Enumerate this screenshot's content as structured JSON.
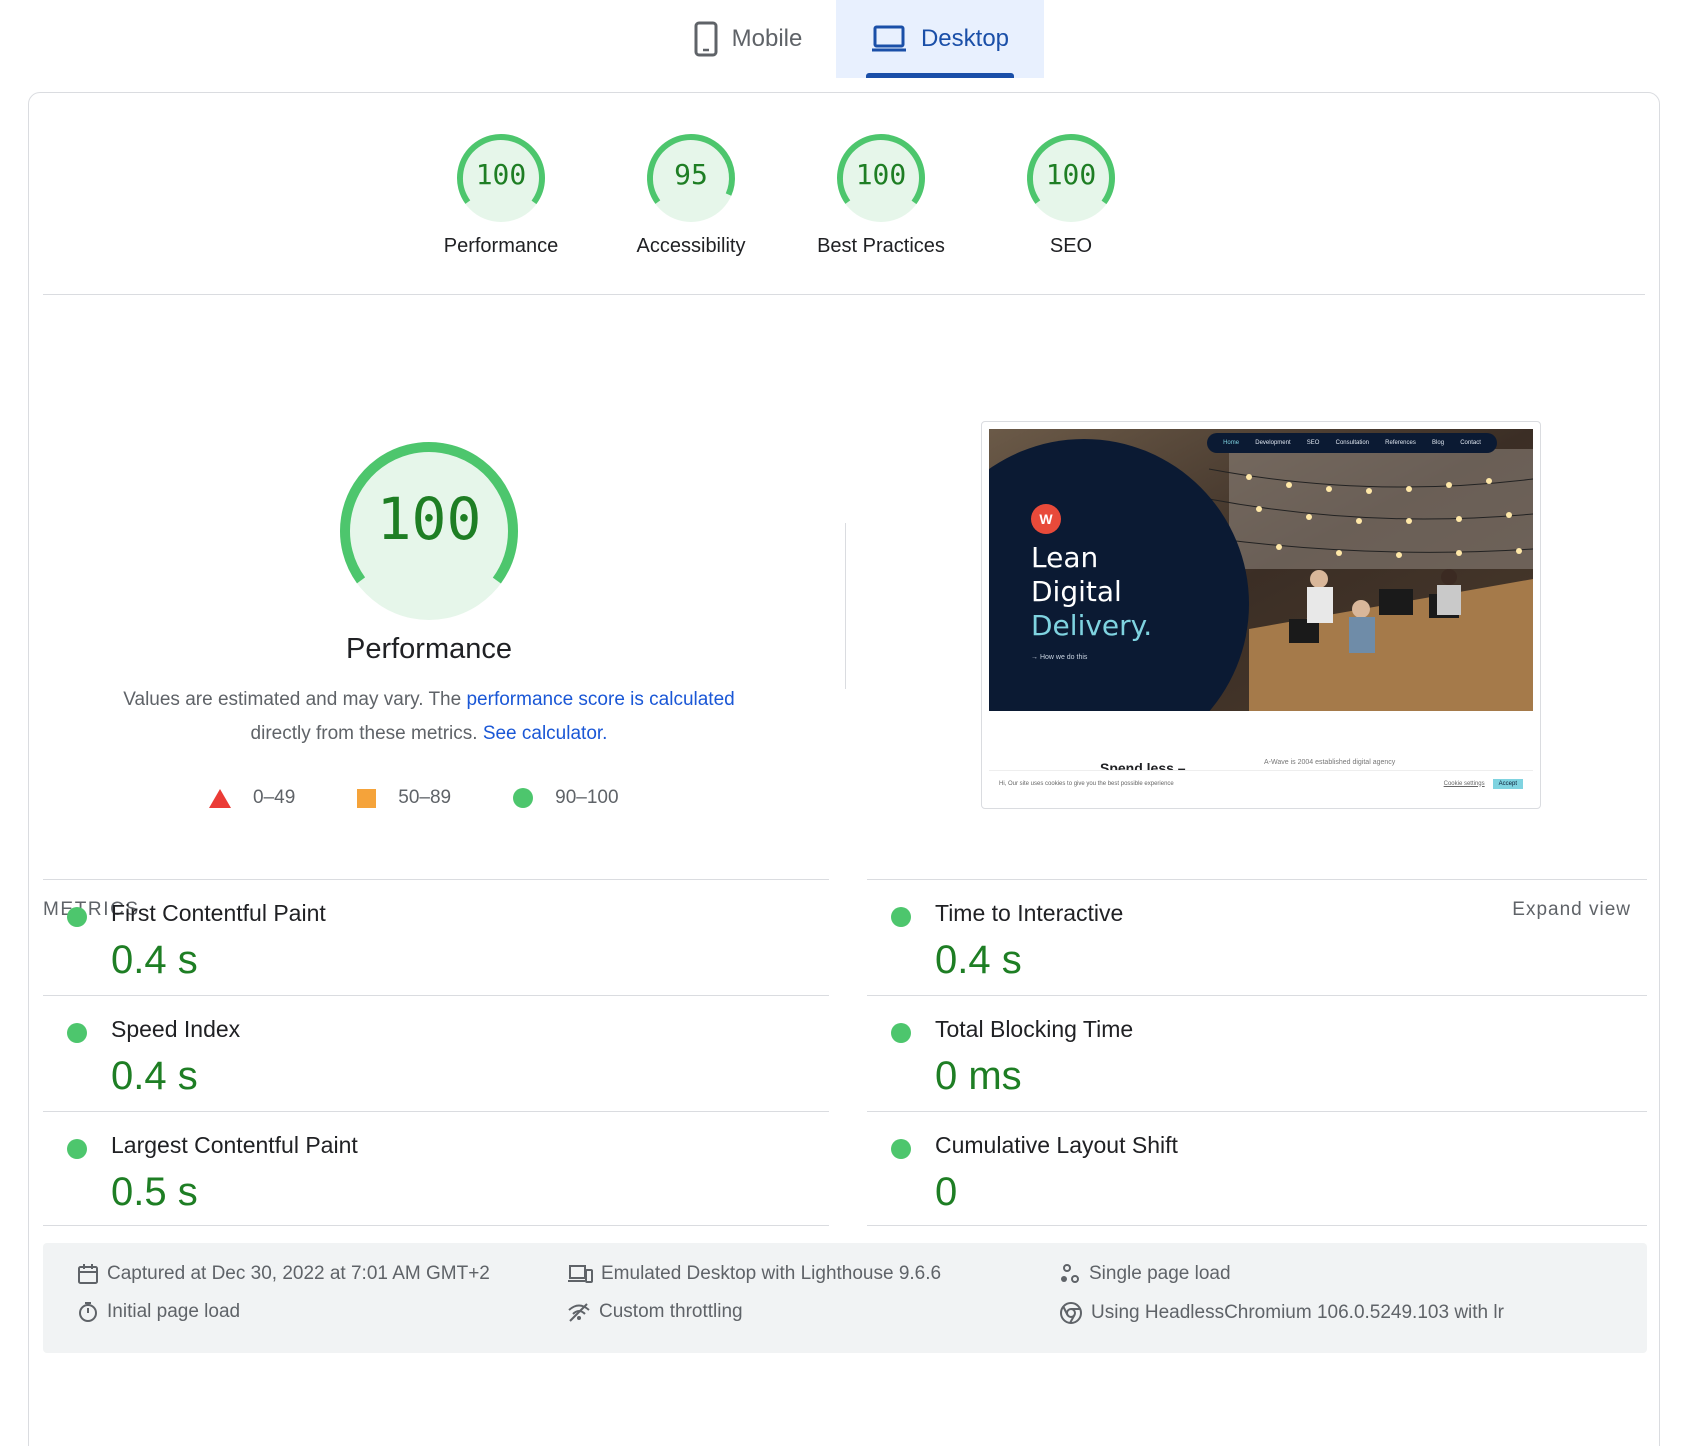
{
  "tabs": [
    {
      "label": "Mobile",
      "icon": "mobile-icon"
    },
    {
      "label": "Desktop",
      "icon": "laptop-icon",
      "selected": true
    }
  ],
  "scores": [
    {
      "value": "100",
      "score": 100,
      "label": "Performance"
    },
    {
      "value": "95",
      "score": 95,
      "label": "Accessibility"
    },
    {
      "value": "100",
      "score": 100,
      "label": "Best Practices"
    },
    {
      "value": "100",
      "score": 100,
      "label": "SEO"
    }
  ],
  "performance": {
    "value": "100",
    "score": 100,
    "title": "Performance",
    "desc_prefix": "Values are estimated and may vary. The ",
    "desc_link1": "performance score is calculated",
    "desc_middle": " directly from these metrics. ",
    "desc_link2": "See calculator."
  },
  "legend": [
    {
      "range": "0–49",
      "shape": "triangle",
      "color": "#eb3b36"
    },
    {
      "range": "50–89",
      "shape": "square",
      "color": "#f5a33a"
    },
    {
      "range": "90–100",
      "shape": "circle",
      "color": "#4dc66d"
    }
  ],
  "screenshot": {
    "nav": [
      "Home",
      "Development",
      "SEO",
      "Consultation",
      "References",
      "Blog",
      "Contact"
    ],
    "logo": "W",
    "headline_line1": "Lean",
    "headline_line2": "Digital",
    "headline_line3": "Delivery.",
    "cta": "→  How we do this",
    "subheading": "Spend less –",
    "subtext": "A-Wave is 2004 established digital agency",
    "cookie_text": "Hi, Our site uses cookies to give you the best possible experience",
    "cookie_settings": "Cookie settings",
    "cookie_accept": "Accept"
  },
  "metrics": {
    "header": "METRICS",
    "expand_label": "Expand view",
    "items": [
      {
        "name": "First Contentful Paint",
        "value": "0.4 s"
      },
      {
        "name": "Time to Interactive",
        "value": "0.4 s"
      },
      {
        "name": "Speed Index",
        "value": "0.4 s"
      },
      {
        "name": "Total Blocking Time",
        "value": "0 ms"
      },
      {
        "name": "Largest Contentful Paint",
        "value": "0.5 s"
      },
      {
        "name": "Cumulative Layout Shift",
        "value": "0"
      }
    ]
  },
  "footer": {
    "captured": "Captured at Dec 30, 2022 at 7:01 AM GMT+2",
    "emulated": "Emulated Desktop with Lighthouse 9.6.6",
    "single": "Single page load",
    "initial": "Initial page load",
    "throttling": "Custom throttling",
    "browser": "Using HeadlessChromium 106.0.5249.103 with lr"
  },
  "colors": {
    "pass_green": "#1e7e24",
    "pass_ring": "#4dc66d",
    "pass_fill": "#e6f6ea",
    "tab_accent": "#1a4fa8",
    "link": "#1a57d6"
  }
}
